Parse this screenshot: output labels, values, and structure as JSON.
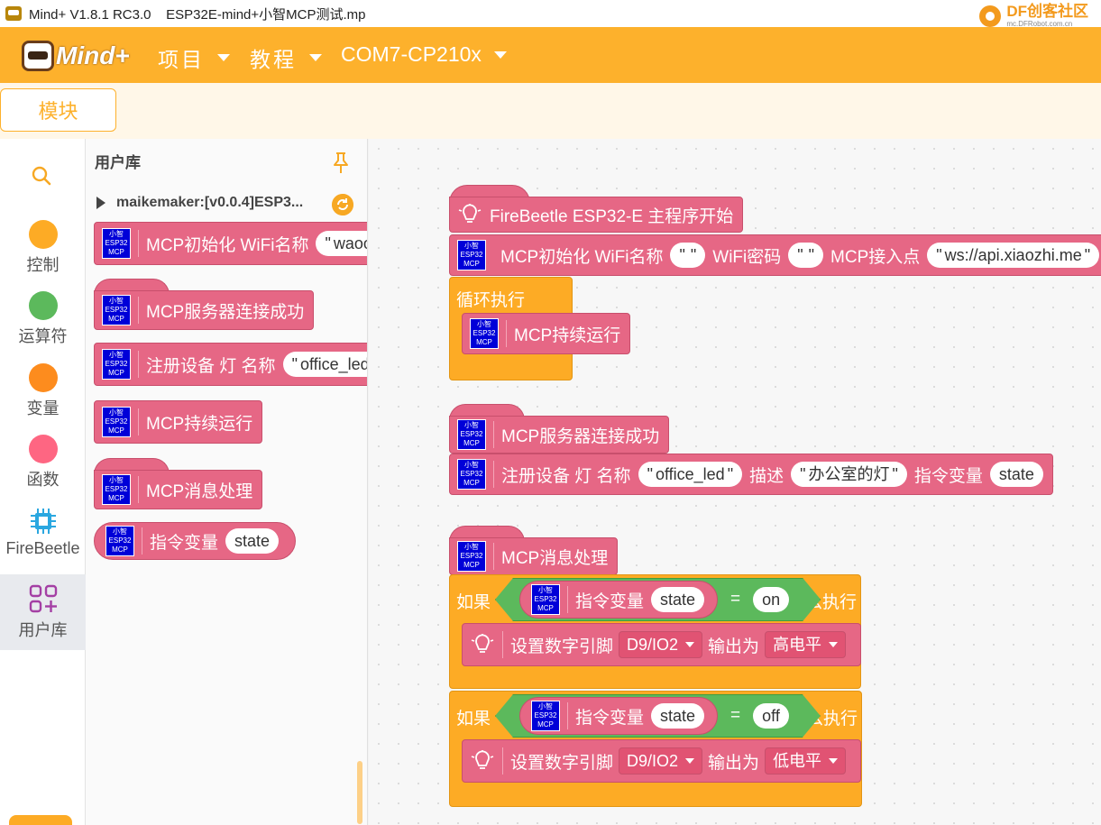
{
  "window": {
    "title": "Mind+ V1.8.1 RC3.0    ESP32E-mind+小智MCP测试.mp"
  },
  "brand": {
    "df_logo": "DF创客社区",
    "df_url": "mc.DFRobot.com.cn",
    "mind_logo": "Mind+"
  },
  "menu": {
    "project": "项目",
    "tutorial": "教程",
    "port": "COM7-CP210x"
  },
  "tabs": {
    "modules": "模块"
  },
  "categories": [
    {
      "label": "控制",
      "color": "#fdab25"
    },
    {
      "label": "运算符",
      "color": "#5cb95c"
    },
    {
      "label": "变量",
      "color": "#fd8c1e"
    },
    {
      "label": "函数",
      "color": "#fe6682"
    },
    {
      "label": "FireBeetle",
      "icon": "chip-icon"
    },
    {
      "label": "用户库",
      "icon": "grid-icon"
    }
  ],
  "flyout": {
    "title": "用户库",
    "library": "maikemaker:[v0.0.4]ESP3...",
    "blocks": {
      "init_label": "MCP初始化 WiFi名称",
      "init_value": "waoo",
      "server_ok": "MCP服务器连接成功",
      "register_label": "注册设备 灯 名称",
      "register_value": "office_led",
      "keep_running": "MCP持续运行",
      "msg_handle": "MCP消息处理",
      "cmd_var_label": "指令变量",
      "cmd_var_value": "state"
    }
  },
  "mcp_icon": {
    "line1": "小智",
    "line2": "ESP32",
    "line3": "MCP"
  },
  "workspace": {
    "main_start": "FireBeetle ESP32-E 主程序开始",
    "init": {
      "label": "MCP初始化 WiFi名称",
      "ssid": " ",
      "pwd_label": "WiFi密码",
      "pwd": " ",
      "endpoint_label": "MCP接入点",
      "endpoint": "ws://api.xiaozhi.me"
    },
    "loop_label": "循环执行",
    "keep_running": "MCP持续运行",
    "server_ok": "MCP服务器连接成功",
    "register": {
      "label": "注册设备 灯 名称",
      "name": "office_led",
      "desc_label": "描述",
      "desc": "办公室的灯",
      "var_label": "指令变量",
      "var": "state"
    },
    "msg_handle": "MCP消息处理",
    "if1": {
      "if_label": "如果",
      "var_label": "指令变量",
      "var": "state",
      "eq": "=",
      "value": "on",
      "then_label": "那么执行"
    },
    "set1": {
      "label": "设置数字引脚",
      "pin": "D9/IO2",
      "out_label": "输出为",
      "level": "高电平"
    },
    "if2": {
      "if_label": "如果",
      "var_label": "指令变量",
      "var": "state",
      "eq": "=",
      "value": "off",
      "then_label": "那么执行"
    },
    "set2": {
      "label": "设置数字引脚",
      "pin": "D9/IO2",
      "out_label": "输出为",
      "level": "低电平"
    }
  }
}
